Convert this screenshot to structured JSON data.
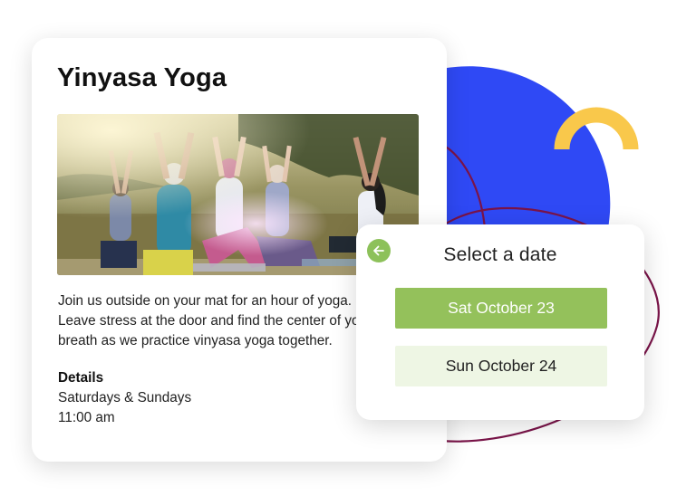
{
  "event": {
    "title": "Yinyasa Yoga",
    "photo": "yoga-class-outdoors-photo",
    "description": [
      "Join us outside on your mat for an hour of  yoga.",
      "Leave stress at the door and find the center of your",
      "breath as we practice vinyasa yoga together."
    ],
    "details_heading": "Details",
    "details_lines": [
      "Saturdays & Sundays",
      "11:00 am"
    ]
  },
  "date_picker": {
    "back_icon": "arrow-left-icon",
    "heading": "Select a date",
    "options": [
      {
        "label": "Sat October 23",
        "selected": true
      },
      {
        "label": "Sun October 24",
        "selected": false
      }
    ]
  },
  "colors": {
    "blue_blob": "#2f49f5",
    "yellow_arc": "#f9c84b",
    "maroon_line": "#7a1449",
    "green_accent": "#94c15b",
    "green_light": "#eef6e4"
  }
}
